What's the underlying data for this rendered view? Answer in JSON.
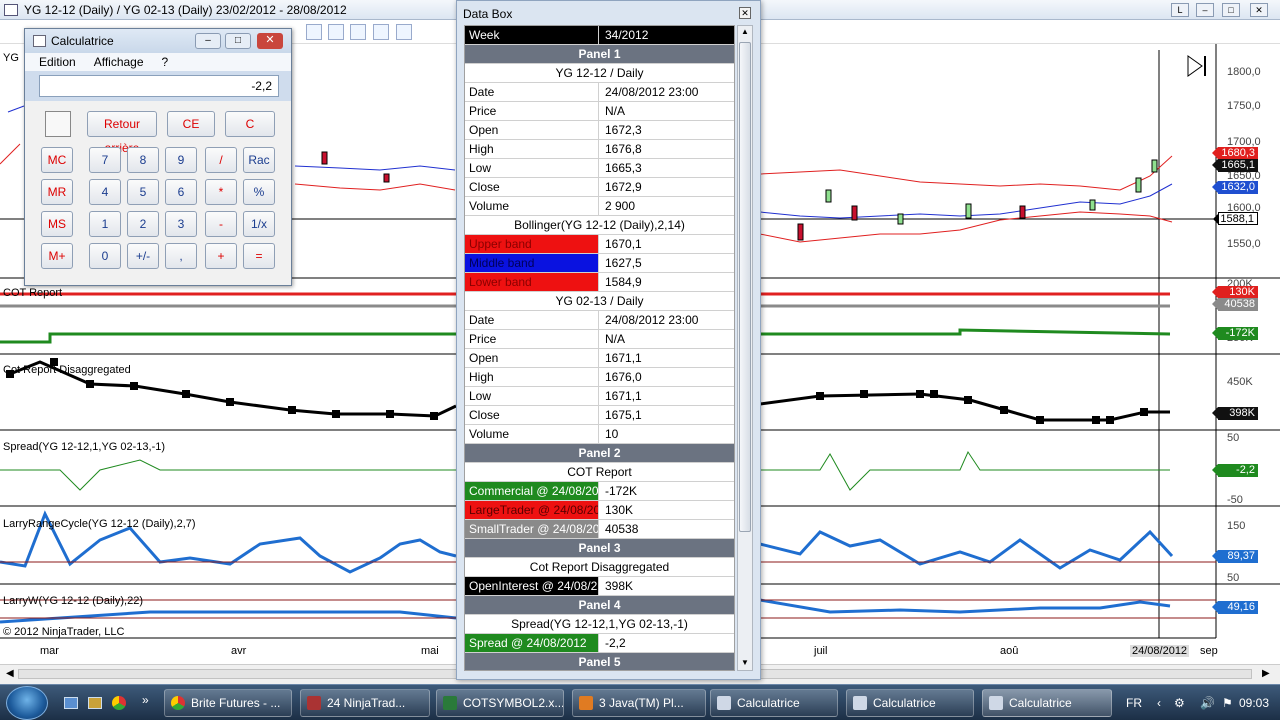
{
  "window": {
    "title": "YG 12-12 (Daily) / YG 02-13 (Daily)  23/02/2012 - 28/08/2012"
  },
  "panels": {
    "price_yaxis": [
      "1800,0",
      "1750,0",
      "1700,0",
      "1650,0",
      "1600,0",
      "1550,0"
    ],
    "price_tags": [
      {
        "text": "1680,3",
        "color": "#e0201e"
      },
      {
        "text": "1665,1",
        "color": "#111111"
      },
      {
        "text": "1632,0",
        "color": "#1f4fd0"
      },
      {
        "text": "1588,1",
        "color": "#ffffff"
      }
    ],
    "cot_label": "COT Report",
    "cot_yaxis": [
      "200K",
      "250K"
    ],
    "cot_tags": [
      {
        "text": "130K",
        "color": "#e0201e"
      },
      {
        "text": "40538",
        "color": "#8a8a8a"
      },
      {
        "text": "-172K",
        "color": "#1f8a1f"
      }
    ],
    "disagg_label": "Cot Report Disaggregated",
    "disagg_yaxis": [
      "450K"
    ],
    "disagg_tag": "398K",
    "spread_label": "Spread(YG 12-12,1,YG 02-13,-1)",
    "spread_yaxis": [
      "50",
      "-50"
    ],
    "spread_tag": "-2,2",
    "larry_label": "LarryRangeCycle(YG 12-12 (Daily),2,7)",
    "larry_yaxis": [
      "150",
      "50"
    ],
    "larry_tag": "89,37",
    "larryw_label": "LarryW(YG 12-12 (Daily),22)",
    "larryw_tag": "49,16",
    "copyright": "© 2012 NinjaTrader, LLC",
    "months": [
      "mar",
      "avr",
      "mai",
      "juil",
      "aoû",
      "sep"
    ],
    "date_badge": "24/08/2012"
  },
  "calculator": {
    "title": "Calculatrice",
    "menu": [
      "Edition",
      "Affichage",
      "?"
    ],
    "display": "-2,2",
    "buttons": {
      "backspace": "Retour arrière",
      "ce": "CE",
      "c": "C",
      "mc": "MC",
      "mr": "MR",
      "ms": "MS",
      "mplus": "M+",
      "n7": "7",
      "n8": "8",
      "n9": "9",
      "div": "/",
      "sqrt": "Rac",
      "n4": "4",
      "n5": "5",
      "n6": "6",
      "mul": "*",
      "pct": "%",
      "n1": "1",
      "n2": "2",
      "n3": "3",
      "sub": "-",
      "inv": "1/x",
      "n0": "0",
      "sign": "+/-",
      "dot": ",",
      "add": "+",
      "eq": "="
    }
  },
  "databox": {
    "title": "Data Box",
    "week_label": "Week",
    "week_value": "34/2012",
    "panel1": "Panel 1",
    "p1_sub1": "YG 12-12 / Daily",
    "p1_rows": [
      [
        "Date",
        "24/08/2012 23:00"
      ],
      [
        "Price",
        "N/A"
      ],
      [
        "Open",
        "1672,3"
      ],
      [
        "High",
        "1676,8"
      ],
      [
        "Low",
        "1665,3"
      ],
      [
        "Close",
        "1672,9"
      ],
      [
        "Volume",
        "2 900"
      ]
    ],
    "p1_sub2": "Bollinger(YG 12-12 (Daily),2,14)",
    "p1_boll": [
      [
        "Upper band",
        "1670,1"
      ],
      [
        "Middle band",
        "1627,5"
      ],
      [
        "Lower band",
        "1584,9"
      ]
    ],
    "p1_sub3": "YG 02-13 / Daily",
    "p1_rows2": [
      [
        "Date",
        "24/08/2012 23:00"
      ],
      [
        "Price",
        "N/A"
      ],
      [
        "Open",
        "1671,1"
      ],
      [
        "High",
        "1676,0"
      ],
      [
        "Low",
        "1671,1"
      ],
      [
        "Close",
        "1675,1"
      ],
      [
        "Volume",
        "10"
      ]
    ],
    "panel2": "Panel 2",
    "p2_sub": "COT Report",
    "p2_rows": [
      [
        "Commercial @ 24/08/20",
        "-172K"
      ],
      [
        "LargeTrader @ 24/08/20",
        "130K"
      ],
      [
        "SmallTrader @ 24/08/20",
        "40538"
      ]
    ],
    "panel3": "Panel 3",
    "p3_sub": "Cot Report Disaggregated",
    "p3_row": [
      "OpenInterest @ 24/08/2",
      "398K"
    ],
    "panel4": "Panel 4",
    "p4_sub": "Spread(YG 12-12,1,YG 02-13,-1)",
    "p4_row": [
      "Spread @ 24/08/2012",
      "-2,2"
    ],
    "panel5": "Panel 5"
  },
  "taskbar": {
    "items": [
      "Brite Futures - ...",
      "24 NinjaTrad...",
      "COTSYMBOL2.x...",
      "3 Java(TM) Pl...",
      "Calculatrice",
      "Calculatrice",
      "Calculatrice"
    ],
    "lang": "FR",
    "clock": "09:03"
  }
}
